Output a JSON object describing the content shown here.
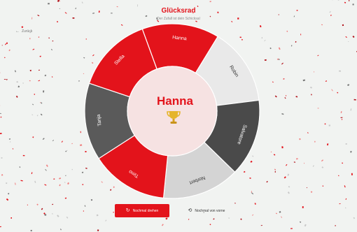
{
  "header": {
    "title": "Glücksrad",
    "subtitle": "Der Zufall ist dein Schicksal"
  },
  "nav": {
    "back_label": "Zurück",
    "back_icon": "arrow-left-icon"
  },
  "wheel": {
    "segments": [
      {
        "label": "Hanna",
        "color": "#e3131b",
        "text_color": "#ffffff"
      },
      {
        "label": "Robin",
        "color": "#e9e9e9",
        "text_color": "#333333"
      },
      {
        "label": "Salvatore",
        "color": "#4a4a4a",
        "text_color": "#ffffff"
      },
      {
        "label": "Norbert",
        "color": "#d4d4d4",
        "text_color": "#333333"
      },
      {
        "label": "Timo",
        "color": "#e3131b",
        "text_color": "#ffffff"
      },
      {
        "label": "Tanja",
        "color": "#5a5a5a",
        "text_color": "#ffffff"
      },
      {
        "label": "Stella",
        "color": "#e3131b",
        "text_color": "#ffffff"
      }
    ],
    "winner": "Hanna",
    "trophy_icon": "trophy-icon"
  },
  "actions": {
    "spin_again_label": "Nochmal drehen",
    "spin_again_icon": "refresh-icon",
    "restart_label": "Nochmal von vorne",
    "restart_icon": "restart-icon"
  },
  "colors": {
    "accent": "#e3131b",
    "background": "#f1f3f1"
  }
}
